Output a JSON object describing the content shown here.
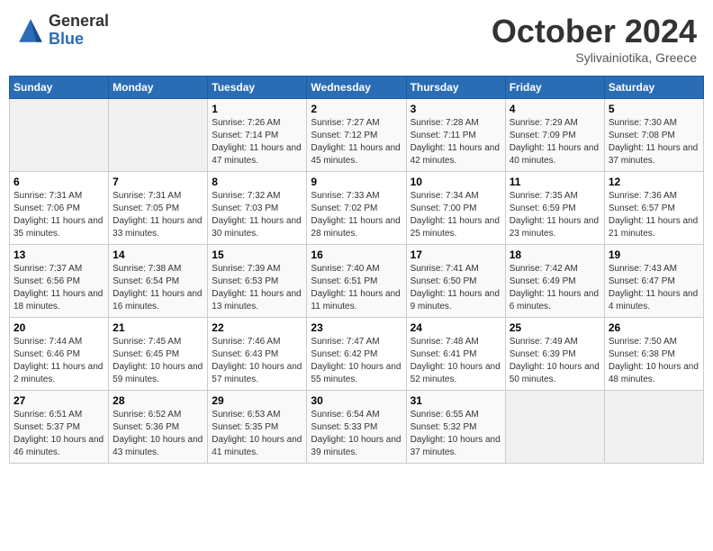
{
  "logo": {
    "general": "General",
    "blue": "Blue"
  },
  "title": "October 2024",
  "location": "Sylivainiotika, Greece",
  "days_of_week": [
    "Sunday",
    "Monday",
    "Tuesday",
    "Wednesday",
    "Thursday",
    "Friday",
    "Saturday"
  ],
  "weeks": [
    [
      {
        "day": "",
        "sunrise": "",
        "sunset": "",
        "daylight": ""
      },
      {
        "day": "",
        "sunrise": "",
        "sunset": "",
        "daylight": ""
      },
      {
        "day": "1",
        "sunrise": "Sunrise: 7:26 AM",
        "sunset": "Sunset: 7:14 PM",
        "daylight": "Daylight: 11 hours and 47 minutes."
      },
      {
        "day": "2",
        "sunrise": "Sunrise: 7:27 AM",
        "sunset": "Sunset: 7:12 PM",
        "daylight": "Daylight: 11 hours and 45 minutes."
      },
      {
        "day": "3",
        "sunrise": "Sunrise: 7:28 AM",
        "sunset": "Sunset: 7:11 PM",
        "daylight": "Daylight: 11 hours and 42 minutes."
      },
      {
        "day": "4",
        "sunrise": "Sunrise: 7:29 AM",
        "sunset": "Sunset: 7:09 PM",
        "daylight": "Daylight: 11 hours and 40 minutes."
      },
      {
        "day": "5",
        "sunrise": "Sunrise: 7:30 AM",
        "sunset": "Sunset: 7:08 PM",
        "daylight": "Daylight: 11 hours and 37 minutes."
      }
    ],
    [
      {
        "day": "6",
        "sunrise": "Sunrise: 7:31 AM",
        "sunset": "Sunset: 7:06 PM",
        "daylight": "Daylight: 11 hours and 35 minutes."
      },
      {
        "day": "7",
        "sunrise": "Sunrise: 7:31 AM",
        "sunset": "Sunset: 7:05 PM",
        "daylight": "Daylight: 11 hours and 33 minutes."
      },
      {
        "day": "8",
        "sunrise": "Sunrise: 7:32 AM",
        "sunset": "Sunset: 7:03 PM",
        "daylight": "Daylight: 11 hours and 30 minutes."
      },
      {
        "day": "9",
        "sunrise": "Sunrise: 7:33 AM",
        "sunset": "Sunset: 7:02 PM",
        "daylight": "Daylight: 11 hours and 28 minutes."
      },
      {
        "day": "10",
        "sunrise": "Sunrise: 7:34 AM",
        "sunset": "Sunset: 7:00 PM",
        "daylight": "Daylight: 11 hours and 25 minutes."
      },
      {
        "day": "11",
        "sunrise": "Sunrise: 7:35 AM",
        "sunset": "Sunset: 6:59 PM",
        "daylight": "Daylight: 11 hours and 23 minutes."
      },
      {
        "day": "12",
        "sunrise": "Sunrise: 7:36 AM",
        "sunset": "Sunset: 6:57 PM",
        "daylight": "Daylight: 11 hours and 21 minutes."
      }
    ],
    [
      {
        "day": "13",
        "sunrise": "Sunrise: 7:37 AM",
        "sunset": "Sunset: 6:56 PM",
        "daylight": "Daylight: 11 hours and 18 minutes."
      },
      {
        "day": "14",
        "sunrise": "Sunrise: 7:38 AM",
        "sunset": "Sunset: 6:54 PM",
        "daylight": "Daylight: 11 hours and 16 minutes."
      },
      {
        "day": "15",
        "sunrise": "Sunrise: 7:39 AM",
        "sunset": "Sunset: 6:53 PM",
        "daylight": "Daylight: 11 hours and 13 minutes."
      },
      {
        "day": "16",
        "sunrise": "Sunrise: 7:40 AM",
        "sunset": "Sunset: 6:51 PM",
        "daylight": "Daylight: 11 hours and 11 minutes."
      },
      {
        "day": "17",
        "sunrise": "Sunrise: 7:41 AM",
        "sunset": "Sunset: 6:50 PM",
        "daylight": "Daylight: 11 hours and 9 minutes."
      },
      {
        "day": "18",
        "sunrise": "Sunrise: 7:42 AM",
        "sunset": "Sunset: 6:49 PM",
        "daylight": "Daylight: 11 hours and 6 minutes."
      },
      {
        "day": "19",
        "sunrise": "Sunrise: 7:43 AM",
        "sunset": "Sunset: 6:47 PM",
        "daylight": "Daylight: 11 hours and 4 minutes."
      }
    ],
    [
      {
        "day": "20",
        "sunrise": "Sunrise: 7:44 AM",
        "sunset": "Sunset: 6:46 PM",
        "daylight": "Daylight: 11 hours and 2 minutes."
      },
      {
        "day": "21",
        "sunrise": "Sunrise: 7:45 AM",
        "sunset": "Sunset: 6:45 PM",
        "daylight": "Daylight: 10 hours and 59 minutes."
      },
      {
        "day": "22",
        "sunrise": "Sunrise: 7:46 AM",
        "sunset": "Sunset: 6:43 PM",
        "daylight": "Daylight: 10 hours and 57 minutes."
      },
      {
        "day": "23",
        "sunrise": "Sunrise: 7:47 AM",
        "sunset": "Sunset: 6:42 PM",
        "daylight": "Daylight: 10 hours and 55 minutes."
      },
      {
        "day": "24",
        "sunrise": "Sunrise: 7:48 AM",
        "sunset": "Sunset: 6:41 PM",
        "daylight": "Daylight: 10 hours and 52 minutes."
      },
      {
        "day": "25",
        "sunrise": "Sunrise: 7:49 AM",
        "sunset": "Sunset: 6:39 PM",
        "daylight": "Daylight: 10 hours and 50 minutes."
      },
      {
        "day": "26",
        "sunrise": "Sunrise: 7:50 AM",
        "sunset": "Sunset: 6:38 PM",
        "daylight": "Daylight: 10 hours and 48 minutes."
      }
    ],
    [
      {
        "day": "27",
        "sunrise": "Sunrise: 6:51 AM",
        "sunset": "Sunset: 5:37 PM",
        "daylight": "Daylight: 10 hours and 46 minutes."
      },
      {
        "day": "28",
        "sunrise": "Sunrise: 6:52 AM",
        "sunset": "Sunset: 5:36 PM",
        "daylight": "Daylight: 10 hours and 43 minutes."
      },
      {
        "day": "29",
        "sunrise": "Sunrise: 6:53 AM",
        "sunset": "Sunset: 5:35 PM",
        "daylight": "Daylight: 10 hours and 41 minutes."
      },
      {
        "day": "30",
        "sunrise": "Sunrise: 6:54 AM",
        "sunset": "Sunset: 5:33 PM",
        "daylight": "Daylight: 10 hours and 39 minutes."
      },
      {
        "day": "31",
        "sunrise": "Sunrise: 6:55 AM",
        "sunset": "Sunset: 5:32 PM",
        "daylight": "Daylight: 10 hours and 37 minutes."
      },
      {
        "day": "",
        "sunrise": "",
        "sunset": "",
        "daylight": ""
      },
      {
        "day": "",
        "sunrise": "",
        "sunset": "",
        "daylight": ""
      }
    ]
  ]
}
